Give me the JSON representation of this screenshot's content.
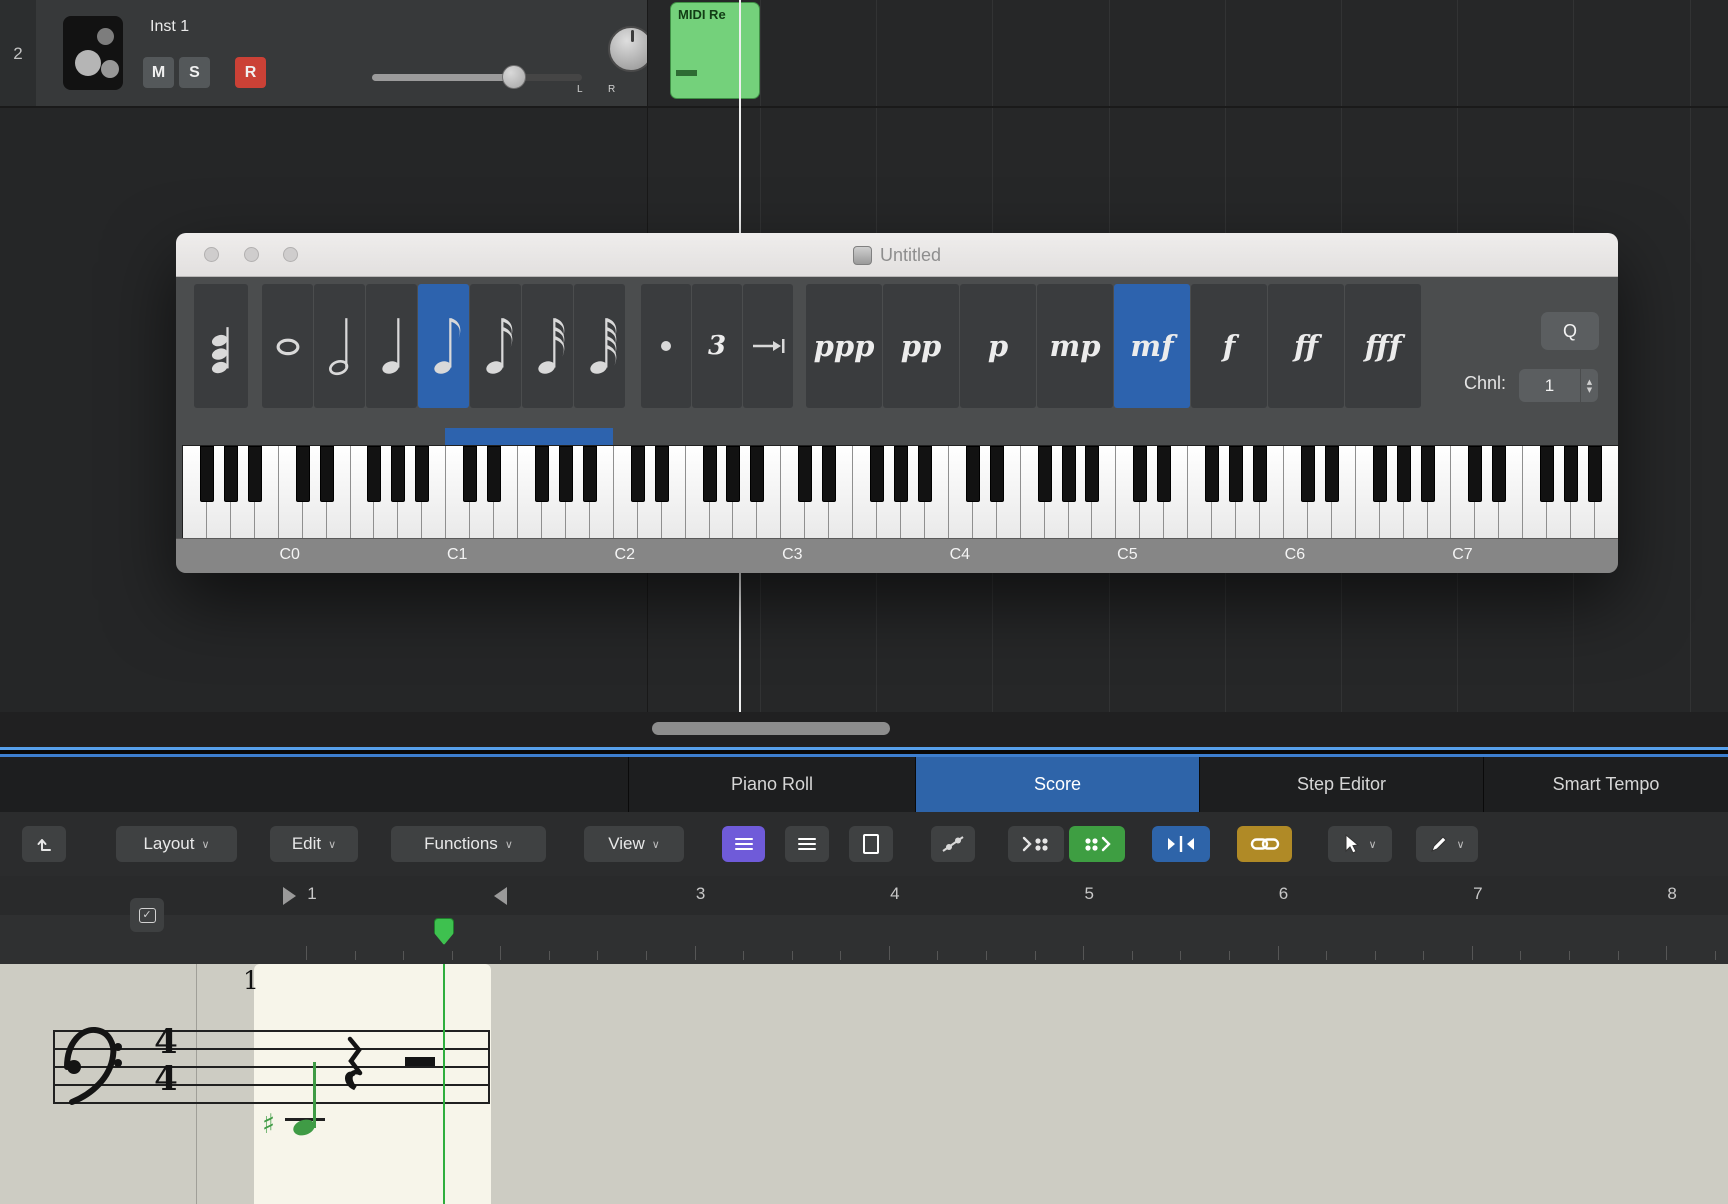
{
  "track": {
    "number": "2",
    "name": "Inst 1",
    "mute_label": "M",
    "solo_label": "S",
    "record_label": "R",
    "pan_left_label": "L",
    "pan_right_label": "R"
  },
  "arrange": {
    "region_name": "MIDI Re"
  },
  "step_input": {
    "window_title": "Untitled",
    "note_values": [
      "chord",
      "whole",
      "half",
      "quarter",
      "eighth",
      "sixteenth",
      "thirty-second",
      "sixty-fourth"
    ],
    "selected_note_value": "eighth",
    "triplet_label": "3",
    "dynamics": [
      "ppp",
      "pp",
      "p",
      "mp",
      "mf",
      "f",
      "ff",
      "fff"
    ],
    "selected_dynamic": "mf",
    "quantize_label": "Q",
    "channel_label": "Chnl:",
    "channel_value": "1",
    "octave_labels": [
      "C0",
      "C1",
      "C2",
      "C3",
      "C4",
      "C5",
      "C6",
      "C7"
    ]
  },
  "editor": {
    "tabs": [
      "Piano Roll",
      "Score",
      "Step Editor",
      "Smart Tempo"
    ],
    "selected_tab": "Score",
    "menus": [
      "Layout",
      "Edit",
      "Functions",
      "View"
    ]
  },
  "ruler": {
    "bar_numbers": [
      1,
      3,
      4,
      5,
      6,
      7,
      8
    ]
  },
  "score": {
    "bar_number": "1",
    "time_signature_top": "4",
    "time_signature_bottom": "4"
  },
  "icons": {
    "chevron_down": "∨",
    "check": "✓",
    "stepper_up": "▲",
    "stepper_down": "▼",
    "sharp": "♯"
  }
}
